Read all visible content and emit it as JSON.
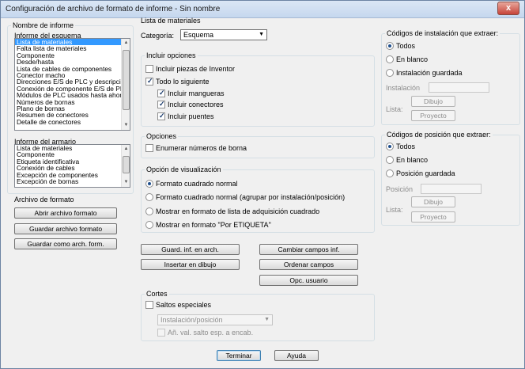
{
  "window": {
    "title": "Configuración de archivo de formato de informe - Sin nombre",
    "close_label": "x"
  },
  "report_name": {
    "group_label": "Nombre de informe",
    "schematic_label": "Informe del esquema",
    "schematic_items": [
      "Lista de materiales",
      "Falta lista de materiales",
      "Componente",
      "Desde/hasta",
      "Lista de cables de componentes",
      "Conector macho",
      "Direcciones E/S de PLC y descripciones",
      "Conexión de componente E/S de PLC",
      "Módulos de PLC usados hasta ahora",
      "Números de bornas",
      "Plano de bornas",
      "Resumen de conectores",
      "Detalle de conectores"
    ],
    "panel_label": "Informe del armario",
    "panel_items": [
      "Lista de materiales",
      "Componente",
      "Etiqueta identificativa",
      "Conexión de cables",
      "Excepción de componentes",
      "Excepción de bornas"
    ]
  },
  "format_file": {
    "group_label": "Archivo de formato",
    "open_button": "Abrir archivo formato",
    "save_button": "Guardar archivo formato",
    "save_as_button": "Guardar como arch. form."
  },
  "bom": {
    "group_label": "Lista de materiales",
    "category_label": "Categoría:",
    "category_value": "Esquema",
    "include_options": {
      "group_label": "Incluir opciones",
      "inventor_parts": "Incluir piezas de Inventor",
      "all_following": "Todo lo siguiente",
      "hoses": "Incluir mangueras",
      "connectors": "Incluir conectores",
      "bridges": "Incluir puentes"
    },
    "options": {
      "group_label": "Opciones",
      "enumerate_terminals": "Enumerar números de borna"
    },
    "display": {
      "group_label": "Opción de visualización",
      "normal_grid": "Formato cuadrado normal",
      "normal_grid_grouped": "Formato cuadrado normal (agrupar por instalación/posición)",
      "purchase_list": "Mostrar en formato de lista de adquisición cuadrado",
      "by_tag": "Mostrar en formato \"Por ETIQUETA\""
    },
    "buttons": {
      "save_to_drawing": "Guard. inf. en arch.",
      "insert_in_drawing": "Insertar en dibujo",
      "change_fields": "Cambiar campos inf.",
      "sort_fields": "Ordenar campos",
      "user_option": "Opc. usuario"
    },
    "breaks": {
      "group_label": "Cortes",
      "special_breaks": "Saltos especiales",
      "break_select": "Instalación/posición",
      "add_break_value": "Añ. val. salto esp. a encab."
    }
  },
  "installation_codes": {
    "group_label": "Códigos de instalación que extraer:",
    "all": "Todos",
    "blank": "En blanco",
    "saved": "Instalación guardada",
    "field_label": "Instalación",
    "list_label": "Lista:",
    "drawing_button": "Dibujo",
    "project_button": "Proyecto"
  },
  "location_codes": {
    "group_label": "Códigos de posición que extraer:",
    "all": "Todos",
    "blank": "En blanco",
    "saved": "Posición guardada",
    "field_label": "Posición",
    "list_label": "Lista:",
    "drawing_button": "Dibujo",
    "project_button": "Proyecto"
  },
  "footer": {
    "finish_button": "Terminar",
    "help_button": "Ayuda"
  },
  "colors": {
    "selection": "#3399ff",
    "default_border": "#3c7fb1"
  }
}
